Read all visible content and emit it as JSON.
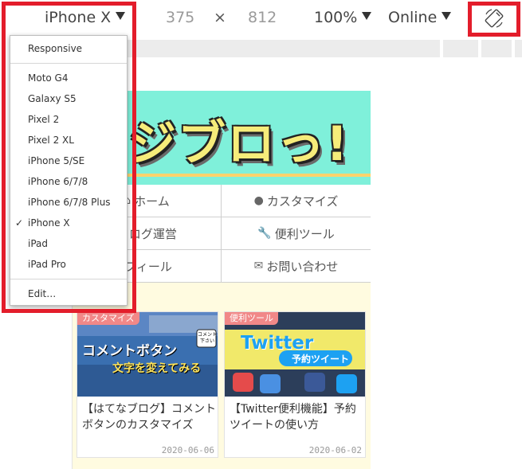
{
  "toolbar": {
    "device_label": "iPhone X",
    "width_value": "375",
    "times_symbol": "×",
    "height_value": "812",
    "zoom_label": "100%",
    "network_label": "Online"
  },
  "device_menu": {
    "items": [
      {
        "label": "Responsive",
        "checked": false
      },
      {
        "label": "Moto G4",
        "checked": false
      },
      {
        "label": "Galaxy S5",
        "checked": false
      },
      {
        "label": "Pixel 2",
        "checked": false
      },
      {
        "label": "Pixel 2 XL",
        "checked": false
      },
      {
        "label": "iPhone 5/SE",
        "checked": false
      },
      {
        "label": "iPhone 6/7/8",
        "checked": false
      },
      {
        "label": "iPhone 6/7/8 Plus",
        "checked": false
      },
      {
        "label": "iPhone X",
        "checked": true
      },
      {
        "label": "iPad",
        "checked": false
      },
      {
        "label": "iPad Pro",
        "checked": false
      },
      {
        "label": "Edit…",
        "checked": false
      }
    ],
    "check_glyph": "✓"
  },
  "page": {
    "banner_text": "ジブロっ!",
    "nav": [
      {
        "icon": "home-icon",
        "label": "ホーム"
      },
      {
        "icon": "palette-icon",
        "label": "カスタマイズ"
      },
      {
        "icon": "pen-icon",
        "label": "ログ運営"
      },
      {
        "icon": "wrench-icon",
        "label": "便利ツール"
      },
      {
        "icon": "user-icon",
        "label": "フィール"
      },
      {
        "icon": "mail-icon",
        "label": "お問い合わせ"
      }
    ],
    "cards": [
      {
        "tag": "カスタマイズ",
        "image_text_main": "コメントボタン",
        "image_text_sub": "文字を変えてみる",
        "image_balloon": "コメント 下さい",
        "title": "【はてなブログ】コメントボタンのカスタマイズ",
        "date": "2020-06-06"
      },
      {
        "tag": "便利ツール",
        "image_text_main": "Twitter",
        "image_text_sub": "予約ツイート",
        "title": "【Twitter便利機能】予約ツイートの使い方",
        "date": "2020-06-02"
      }
    ]
  },
  "colors": {
    "highlight": "#e31d2b",
    "banner_bg": "#7ff0da",
    "page_bg": "#fffbe0",
    "tag_bg": "#f18888"
  }
}
